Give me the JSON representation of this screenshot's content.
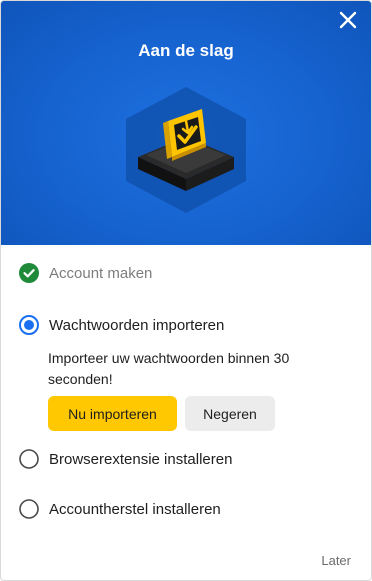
{
  "header": {
    "title": "Aan de slag",
    "background_color": "#1765d2",
    "close_icon": "close-icon",
    "illustration": "import-box-illustration"
  },
  "steps": [
    {
      "label": "Account maken",
      "state": "completed",
      "icon": "check-circle-icon",
      "color": "#1e8a3a"
    },
    {
      "label": "Wachtwoorden importeren",
      "state": "active",
      "icon": "radio-selected-icon",
      "color": "#1a6ff0"
    },
    {
      "label": "Browserextensie installeren",
      "state": "pending",
      "icon": "radio-empty-icon"
    },
    {
      "label": "Accountherstel installeren",
      "state": "pending",
      "icon": "radio-empty-icon"
    }
  ],
  "active_step": {
    "description": "Importeer uw wachtwoorden binnen 30 seconden!",
    "primary_button": "Nu importeren",
    "secondary_button": "Negeren",
    "primary_color": "#ffc800"
  },
  "footer": {
    "later_label": "Later"
  }
}
